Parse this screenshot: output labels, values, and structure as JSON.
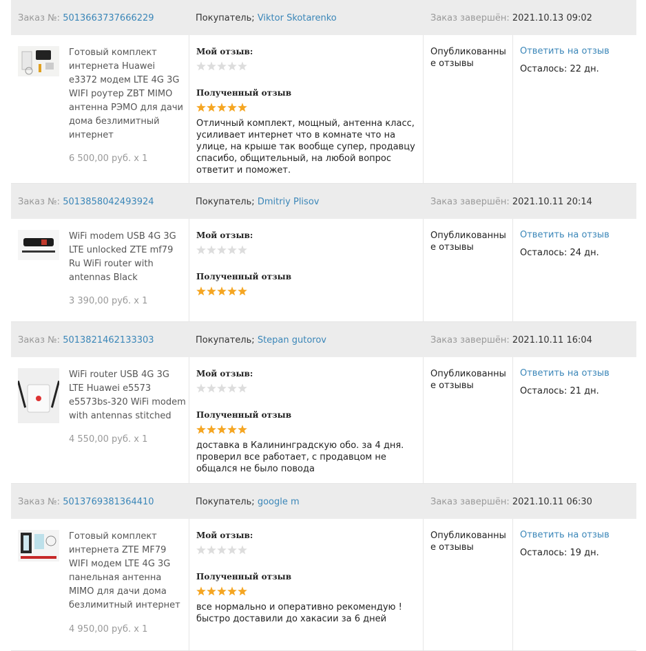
{
  "labels": {
    "order_no": "Заказ №:",
    "buyer": "Покупатель;",
    "completed": "Заказ завершён:",
    "my_review": "Мой отзыв:",
    "received_review": "Полученный отзыв",
    "published": "Опубликованные отзывы",
    "reply": "Ответить на отзыв"
  },
  "colors": {
    "link": "#3a86b8",
    "star_filled": "#f5a623",
    "star_empty": "#dddddd",
    "header_bg": "#ececec"
  },
  "orders": [
    {
      "order_id": "5013663737666229",
      "buyer": "Viktor Skotarenko",
      "completed": "2021.10.13 09:02",
      "product_title": "Готовый комплект интернета Huawei e3372 модем LTE 4G 3G WIFI роутер ZBT MIMO антенна РЭМО для дачи дома безлимитный интернет",
      "product_icon": "modem-kit-thumbnail",
      "price": "6 500,00 руб. x 1",
      "my_review_stars": 0,
      "received_stars": 5,
      "received_text": "Отличный комплект, мощный, антенна класс, усиливает интернет что в комнате что на улице, на крыше так вообще супер, продавцу спасибо, общительный, на любой вопрос ответит и поможет.",
      "days_left": "Осталось: 22 дн."
    },
    {
      "order_id": "5013858042493924",
      "buyer": "Dmitriy Plisov",
      "completed": "2021.10.11 20:14",
      "product_title": "WiFi modem USB 4G 3G LTE unlocked ZTE mf79 Ru WiFi router with antennas Black",
      "product_icon": "usb-modem-thumbnail",
      "price": "3 390,00 руб. x 1",
      "my_review_stars": 0,
      "received_stars": 5,
      "received_text": "",
      "days_left": "Осталось: 24 дн."
    },
    {
      "order_id": "5013821462133303",
      "buyer": "Stepan gutorov",
      "completed": "2021.10.11 16:04",
      "product_title": "WiFi router USB 4G 3G LTE Huawei e5573 e5573bs-320 WiFi modem with antennas stitched",
      "product_icon": "wifi-router-thumbnail",
      "price": "4 550,00 руб. x 1",
      "my_review_stars": 0,
      "received_stars": 5,
      "received_text": "доставка в Калининградскую обо. за 4 дня. проверил все работает, с продавцом не общался не было повода",
      "days_left": "Осталось: 21 дн."
    },
    {
      "order_id": "5013769381364410",
      "buyer": "google m",
      "completed": "2021.10.11 06:30",
      "product_title": "Готовый комплект интернета ZTE MF79 WIFI модем LTE 4G 3G панельная антенна MIMO для дачи дома безлимитный интернет",
      "product_icon": "panel-antenna-kit-thumbnail",
      "price": "4 950,00 руб. x 1",
      "my_review_stars": 0,
      "received_stars": 5,
      "received_text": "все нормально и оперативно рекомендую ! быстро доставили до хакасии за 6 дней",
      "days_left": "Осталось: 19 дн."
    }
  ]
}
